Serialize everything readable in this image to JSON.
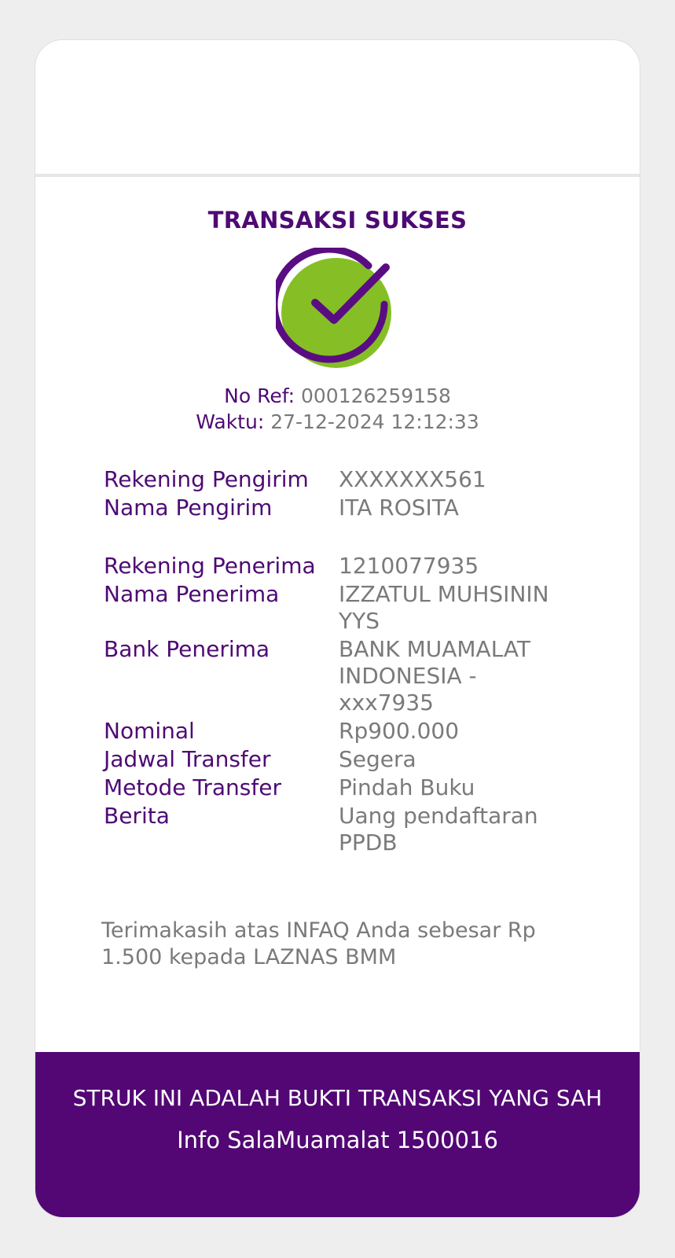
{
  "receipt": {
    "status_title": "TRANSAKSI SUKSES",
    "ref_label": "No Ref:",
    "ref_value": "000126259158",
    "time_label": "Waktu:",
    "time_value": "27-12-2024 12:12:33"
  },
  "details": {
    "sender_account_label": "Rekening Pengirim",
    "sender_account_value": "XXXXXXX561",
    "sender_name_label": "Nama Pengirim",
    "sender_name_value": "ITA ROSITA",
    "recipient_account_label": "Rekening Penerima",
    "recipient_account_value": "1210077935",
    "recipient_name_label": "Nama Penerima",
    "recipient_name_value": "IZZATUL MUHSININ YYS",
    "recipient_bank_label": "Bank Penerima",
    "recipient_bank_value": "BANK MUAMALAT INDONESIA - xxx7935",
    "amount_label": "Nominal",
    "amount_value": "Rp900.000",
    "schedule_label": "Jadwal Transfer",
    "schedule_value": "Segera",
    "method_label": "Metode Transfer",
    "method_value": "Pindah Buku",
    "note_label": "Berita",
    "note_value": "Uang pendaftaran PPDB"
  },
  "thanks_text": "Terimakasih atas INFAQ Anda sebesar Rp 1.500 kepada LAZNAS BMM",
  "footer": {
    "valid_notice": "STRUK INI ADALAH BUKTI TRANSAKSI YANG SAH",
    "info": "Info SalaMuamalat 1500016"
  },
  "colors": {
    "brand_purple": "#520774",
    "success_green": "#86bf25",
    "value_gray": "#7a7a7a"
  },
  "icons": {
    "status": "success-check-icon"
  }
}
